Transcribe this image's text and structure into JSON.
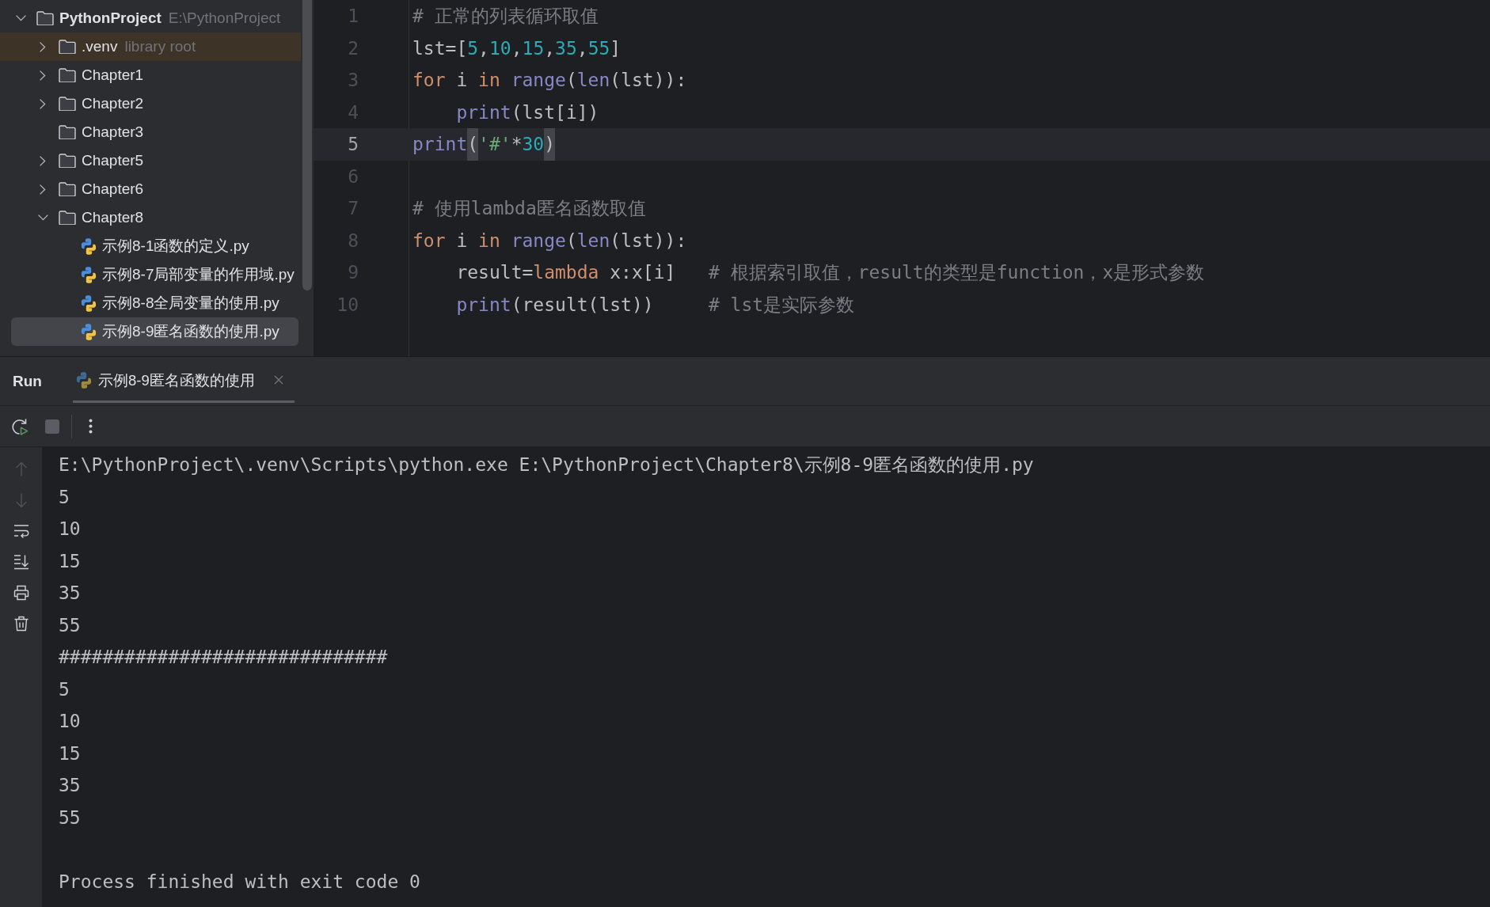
{
  "project_tree": {
    "items": [
      {
        "label": "PythonProject",
        "hint": "E:\\PythonProject",
        "kind": "folder",
        "expandable": true,
        "expanded": true,
        "selected": false,
        "highlighted": false,
        "children": [
          {
            "label": ".venv",
            "hint": "library root",
            "kind": "folder",
            "expandable": true,
            "expanded": false,
            "selected": false,
            "highlighted": true
          },
          {
            "label": "Chapter1",
            "kind": "folder",
            "expandable": true,
            "expanded": false,
            "selected": false,
            "highlighted": false
          },
          {
            "label": "Chapter2",
            "kind": "folder",
            "expandable": true,
            "expanded": false,
            "selected": false,
            "highlighted": false
          },
          {
            "label": "Chapter3",
            "kind": "folder",
            "expandable": false,
            "selected": false,
            "highlighted": false
          },
          {
            "label": "Chapter5",
            "kind": "folder",
            "expandable": true,
            "expanded": false,
            "selected": false,
            "highlighted": false
          },
          {
            "label": "Chapter6",
            "kind": "folder",
            "expandable": true,
            "expanded": false,
            "selected": false,
            "highlighted": false
          },
          {
            "label": "Chapter8",
            "kind": "folder",
            "expandable": true,
            "expanded": true,
            "selected": false,
            "highlighted": false,
            "children": [
              {
                "label": "示例8-1函数的定义.py",
                "kind": "python_file",
                "expandable": false,
                "selected": false,
                "highlighted": false
              },
              {
                "label": "示例8-7局部变量的作用域.py",
                "kind": "python_file",
                "expandable": false,
                "selected": false,
                "highlighted": false
              },
              {
                "label": "示例8-8全局变量的使用.py",
                "kind": "python_file",
                "expandable": false,
                "selected": false,
                "highlighted": false
              },
              {
                "label": "示例8-9匿名函数的使用.py",
                "kind": "python_file",
                "expandable": false,
                "selected": true,
                "highlighted": false
              }
            ]
          }
        ]
      }
    ]
  },
  "editor": {
    "lines": [
      {
        "number": "1",
        "current": false,
        "tokens": [
          {
            "kind": "comment",
            "text": "# 正常的列表循环取值"
          }
        ]
      },
      {
        "number": "2",
        "current": false,
        "tokens": [
          {
            "kind": "plain",
            "text": "lst=["
          },
          {
            "kind": "number",
            "text": "5"
          },
          {
            "kind": "plain",
            "text": ","
          },
          {
            "kind": "number",
            "text": "10"
          },
          {
            "kind": "plain",
            "text": ","
          },
          {
            "kind": "number",
            "text": "15"
          },
          {
            "kind": "plain",
            "text": ","
          },
          {
            "kind": "number",
            "text": "35"
          },
          {
            "kind": "plain",
            "text": ","
          },
          {
            "kind": "number",
            "text": "55"
          },
          {
            "kind": "plain",
            "text": "]"
          }
        ]
      },
      {
        "number": "3",
        "current": false,
        "tokens": [
          {
            "kind": "keyword",
            "text": "for"
          },
          {
            "kind": "plain",
            "text": " i "
          },
          {
            "kind": "keyword",
            "text": "in"
          },
          {
            "kind": "builtin",
            "text": " range"
          },
          {
            "kind": "plain",
            "text": "("
          },
          {
            "kind": "builtin",
            "text": "len"
          },
          {
            "kind": "plain",
            "text": "(lst)):"
          }
        ]
      },
      {
        "number": "4",
        "current": false,
        "tokens": [
          {
            "kind": "builtin",
            "text": "    print"
          },
          {
            "kind": "plain",
            "text": "(lst[i])"
          }
        ]
      },
      {
        "number": "5",
        "current": true,
        "tokens": [
          {
            "kind": "builtin",
            "text": "print"
          },
          {
            "kind": "paren_match",
            "text": "("
          },
          {
            "kind": "string",
            "text": "'#'"
          },
          {
            "kind": "plain",
            "text": "*"
          },
          {
            "kind": "number",
            "text": "30"
          },
          {
            "kind": "paren_match",
            "text": ")"
          }
        ]
      },
      {
        "number": "6",
        "current": false
      },
      {
        "number": "7",
        "current": false,
        "tokens": [
          {
            "kind": "comment",
            "text": "# 使用lambda匿名函数取值"
          }
        ]
      },
      {
        "number": "8",
        "current": false,
        "tokens": [
          {
            "kind": "keyword",
            "text": "for"
          },
          {
            "kind": "plain",
            "text": " i "
          },
          {
            "kind": "keyword",
            "text": "in"
          },
          {
            "kind": "builtin",
            "text": " range"
          },
          {
            "kind": "plain",
            "text": "("
          },
          {
            "kind": "builtin",
            "text": "len"
          },
          {
            "kind": "plain",
            "text": "(lst)):"
          }
        ]
      },
      {
        "number": "9",
        "current": false,
        "tokens": [
          {
            "kind": "plain",
            "text": "    result="
          },
          {
            "kind": "keyword",
            "text": "lambda"
          },
          {
            "kind": "plain",
            "text": " x:x[i]"
          },
          {
            "kind": "comment",
            "text": "   # 根据索引取值，result的类型是function，x是形式参数"
          }
        ]
      },
      {
        "number": "10",
        "current": false,
        "tokens": [
          {
            "kind": "builtin",
            "text": "    print"
          },
          {
            "kind": "plain",
            "text": "(result(lst))"
          },
          {
            "kind": "comment",
            "text": "     # lst是实际参数"
          }
        ]
      }
    ]
  },
  "run_panel": {
    "title": "Run",
    "tabs": [
      {
        "label": "示例8-9匿名函数的使用",
        "selected": true
      }
    ],
    "toolbar": [
      {
        "kind": "rerun",
        "disabled": false
      },
      {
        "kind": "stop",
        "disabled": true
      },
      {
        "kind": "more",
        "disabled": false
      }
    ],
    "side_tools": [
      {
        "kind": "up",
        "disabled": true
      },
      {
        "kind": "down",
        "disabled": true
      },
      {
        "kind": "soft_wrap",
        "disabled": false
      },
      {
        "kind": "scroll_to_end",
        "disabled": false
      },
      {
        "kind": "print",
        "disabled": false
      },
      {
        "kind": "clear",
        "disabled": false
      }
    ],
    "output": {
      "lines": [
        "E:\\PythonProject\\.venv\\Scripts\\python.exe E:\\PythonProject\\Chapter8\\示例8-9匿名函数的使用.py",
        "5",
        "10",
        "15",
        "35",
        "55",
        "##############################",
        "5",
        "10",
        "15",
        "35",
        "55"
      ],
      "exit_message": "Process finished with exit code 0"
    }
  }
}
